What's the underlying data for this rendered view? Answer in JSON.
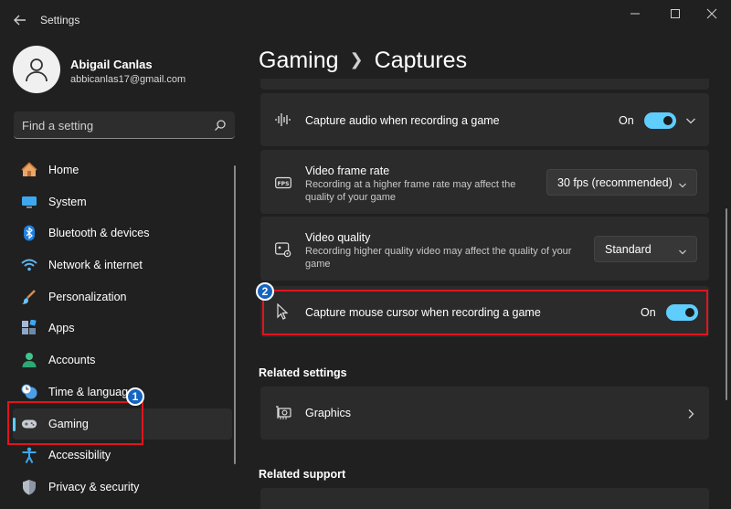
{
  "window": {
    "title": "Settings"
  },
  "user": {
    "name": "Abigail Canlas",
    "email": "abbicanlas17@gmail.com"
  },
  "search": {
    "placeholder": "Find a setting",
    "icon": "search-icon"
  },
  "nav": {
    "items": [
      {
        "label": "Home",
        "icon": "home-icon"
      },
      {
        "label": "System",
        "icon": "monitor-icon"
      },
      {
        "label": "Bluetooth & devices",
        "icon": "bluetooth-icon"
      },
      {
        "label": "Network & internet",
        "icon": "wifi-icon"
      },
      {
        "label": "Personalization",
        "icon": "brush-icon"
      },
      {
        "label": "Apps",
        "icon": "apps-icon"
      },
      {
        "label": "Accounts",
        "icon": "person-icon"
      },
      {
        "label": "Time & language",
        "icon": "clock-globe-icon"
      },
      {
        "label": "Gaming",
        "icon": "gamepad-icon",
        "selected": true
      },
      {
        "label": "Accessibility",
        "icon": "accessibility-icon"
      },
      {
        "label": "Privacy & security",
        "icon": "shield-icon"
      }
    ]
  },
  "breadcrumb": {
    "parent": "Gaming",
    "current": "Captures"
  },
  "settings": {
    "capture_audio": {
      "title": "Capture audio when recording a game",
      "state": "On",
      "icon": "audio-waveform-icon"
    },
    "frame_rate": {
      "title": "Video frame rate",
      "description": "Recording at a higher frame rate may affect the quality of your game",
      "value": "30 fps (recommended)",
      "icon": "fps-icon"
    },
    "video_quality": {
      "title": "Video quality",
      "description": "Recording higher quality video may affect the quality of your game",
      "value": "Standard",
      "icon": "video-quality-icon"
    },
    "mouse_cursor": {
      "title": "Capture mouse cursor when recording a game",
      "state": "On",
      "icon": "cursor-icon"
    }
  },
  "related_settings": {
    "heading": "Related settings",
    "items": [
      {
        "label": "Graphics",
        "icon": "graphics-card-icon"
      }
    ]
  },
  "related_support": {
    "heading": "Related support"
  },
  "annotations": {
    "badge1": "1",
    "badge2": "2"
  },
  "colors": {
    "accent": "#60cdff",
    "highlight": "#e0141e",
    "badge": "#1565c0",
    "background": "#202020",
    "card": "#2b2b2b"
  }
}
